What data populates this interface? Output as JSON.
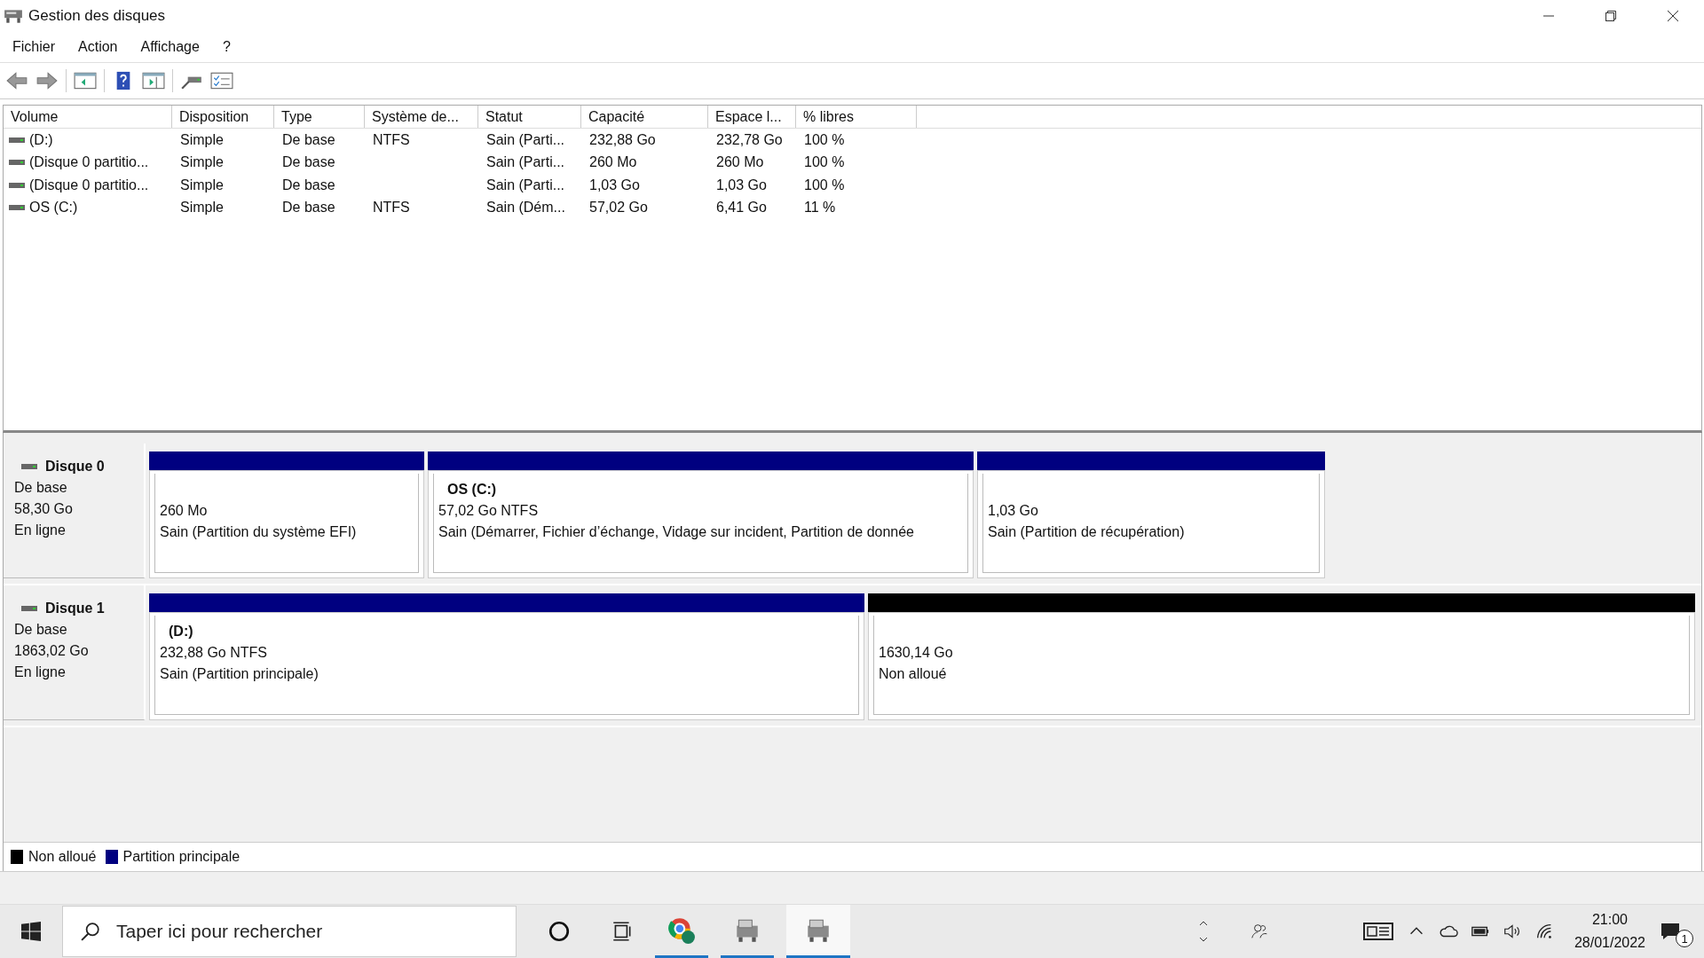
{
  "window": {
    "title": "Gestion des disques"
  },
  "menu": [
    "Fichier",
    "Action",
    "Affichage",
    "?"
  ],
  "table": {
    "columns": [
      "Volume",
      "Disposition",
      "Type",
      "Système de...",
      "Statut",
      "Capacité",
      "Espace l...",
      "% libres"
    ],
    "rows": [
      {
        "volume": "(D:)",
        "layout": "Simple",
        "type": "De base",
        "filesystem": "NTFS",
        "status": "Sain (Parti...",
        "capacity": "232,88 Go",
        "free": "232,78 Go",
        "percent_free": "100 %"
      },
      {
        "volume": "(Disque 0 partitio...",
        "layout": "Simple",
        "type": "De base",
        "status": "Sain (Parti...",
        "capacity": "260 Mo",
        "free": "260 Mo",
        "percent_free": "100 %"
      },
      {
        "volume": "(Disque 0 partitio...",
        "layout": "Simple",
        "type": "De base",
        "status": "Sain (Parti...",
        "capacity": "1,03 Go",
        "free": "1,03 Go",
        "percent_free": "100 %"
      },
      {
        "volume": "OS (C:)",
        "layout": "Simple",
        "type": "De base",
        "filesystem": "NTFS",
        "status": "Sain (Dém...",
        "capacity": "57,02 Go",
        "free": "6,41 Go",
        "percent_free": "11 %"
      }
    ]
  },
  "disks": [
    {
      "name": "Disque 0",
      "type": "De base",
      "size": "58,30 Go",
      "state": "En ligne",
      "partitions": [
        {
          "kind": "primary",
          "color": "#000080",
          "size": "260 Mo",
          "status": "Sain (Partition du système EFI)"
        },
        {
          "kind": "primary",
          "color": "#000080",
          "title": "OS  (C:)",
          "size": "57,02 Go NTFS",
          "status": "Sain (Démarrer, Fichier d’échange, Vidage sur incident, Partition de donnée"
        },
        {
          "kind": "primary",
          "color": "#000080",
          "size": "1,03 Go",
          "status": "Sain (Partition de récupération)"
        }
      ]
    },
    {
      "name": "Disque 1",
      "type": "De base",
      "size": "1863,02 Go",
      "state": "En ligne",
      "partitions": [
        {
          "kind": "primary",
          "color": "#000080",
          "title": "(D:)",
          "size": "232,88 Go NTFS",
          "status": "Sain (Partition principale)"
        },
        {
          "kind": "unallocated",
          "color": "#000000",
          "size": "1630,14 Go",
          "status": "Non alloué"
        }
      ]
    }
  ],
  "legend": [
    {
      "label": "Non alloué",
      "color": "#000000"
    },
    {
      "label": "Partition principale",
      "color": "#000080"
    }
  ],
  "taskbar": {
    "search": {
      "placeholder": "Taper ici pour rechercher"
    },
    "apps": [
      {
        "kind": "browser",
        "selected": false
      },
      {
        "kind": "disk",
        "selected": false
      },
      {
        "kind": "disk",
        "selected": true
      }
    ],
    "time": "21:00",
    "date": "28/01/2022",
    "notifications": "1"
  }
}
